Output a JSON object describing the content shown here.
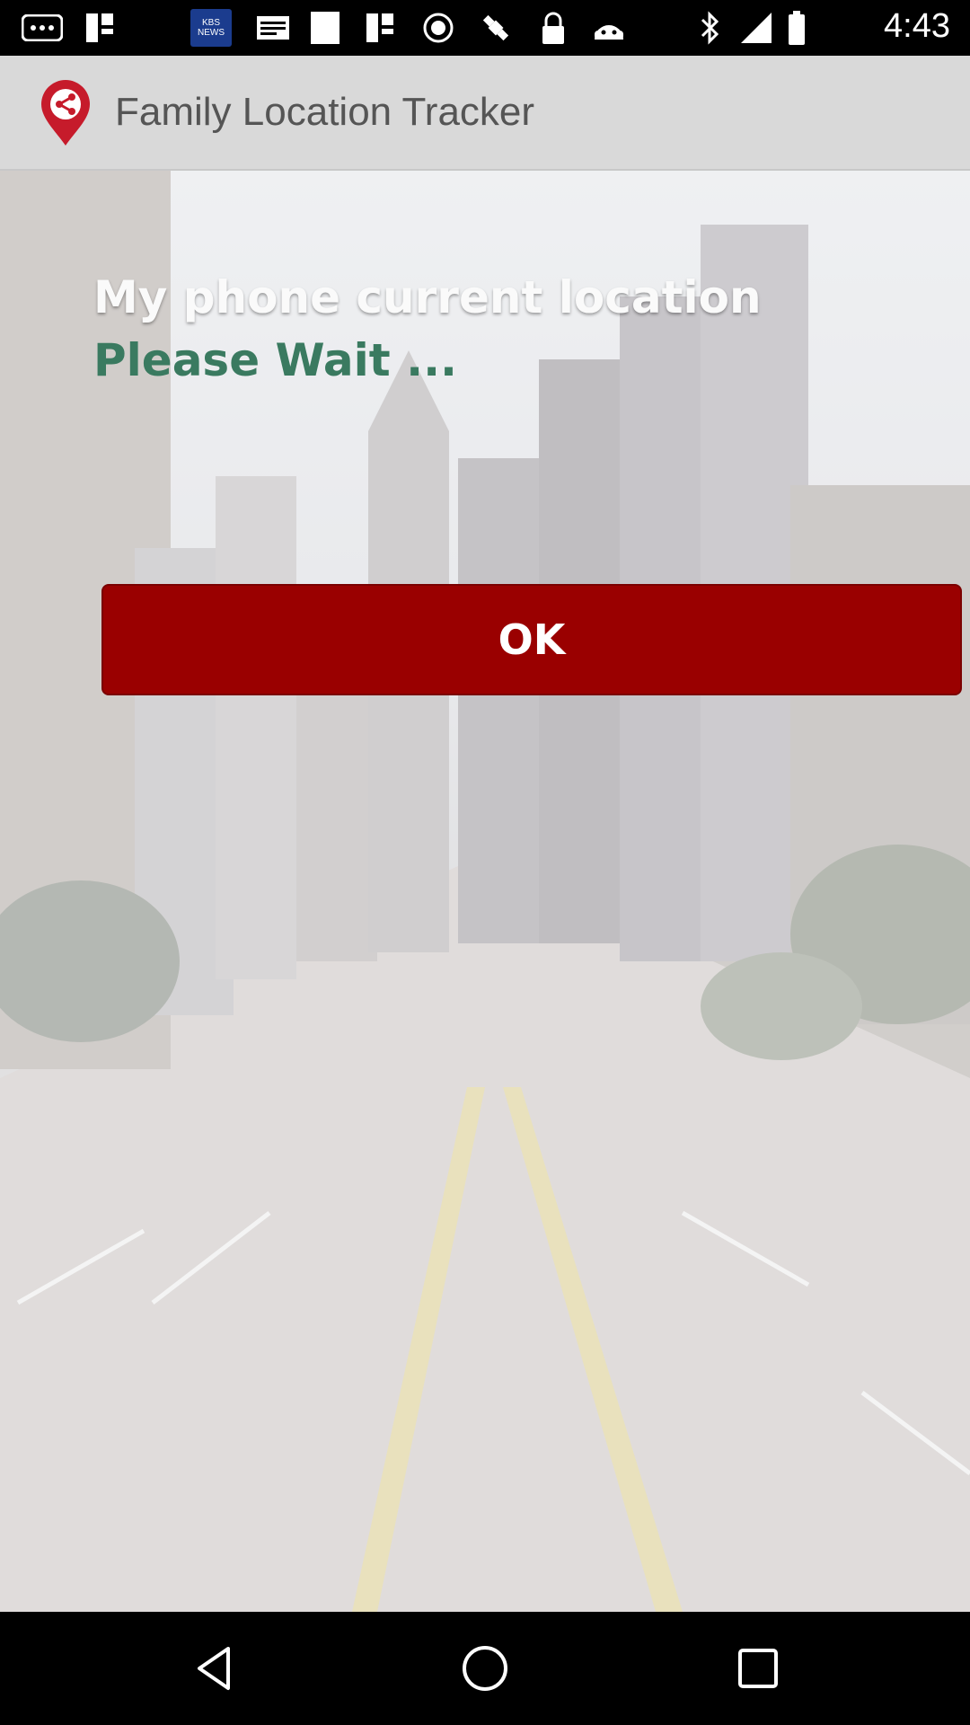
{
  "status_bar": {
    "time": "4:43",
    "left_icons": [
      "more-icon",
      "wifi-share-icon",
      "kbs-news-icon",
      "mail-icon",
      "image-icon",
      "wifi-share-icon",
      "gps-icon",
      "fake-gps-icon",
      "lock-icon",
      "android-icon"
    ],
    "kbs_text": "KBS NEWS",
    "right_icons": [
      "bluetooth-icon",
      "signal-icon",
      "battery-icon"
    ]
  },
  "app_bar": {
    "title": "Family Location Tracker",
    "logo": "location-share-icon"
  },
  "main": {
    "headline": "My phone current location",
    "status": "Please Wait ...",
    "ok_label": "OK",
    "status_color": "#3a7a60",
    "button_color": "#9a0000"
  },
  "nav_bar": {
    "buttons": [
      "back-icon",
      "home-icon",
      "recents-icon"
    ]
  }
}
